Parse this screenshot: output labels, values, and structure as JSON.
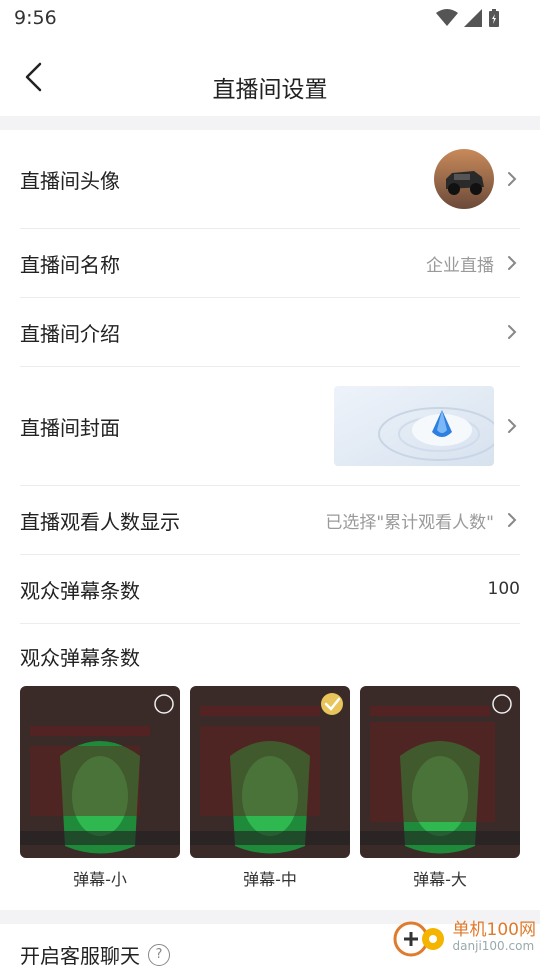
{
  "status": {
    "time": "9:56"
  },
  "header": {
    "title": "直播间设置"
  },
  "rows": {
    "avatar": {
      "label": "直播间头像"
    },
    "name": {
      "label": "直播间名称",
      "value": "企业直播"
    },
    "intro": {
      "label": "直播间介绍"
    },
    "cover": {
      "label": "直播间封面"
    },
    "viewers": {
      "label": "直播观看人数显示",
      "value": "已选择\"累计观看人数\""
    },
    "danmaku_count": {
      "label": "观众弹幕条数",
      "value": "100"
    }
  },
  "danmaku_section": {
    "label": "观众弹幕条数",
    "options": [
      {
        "caption": "弹幕-小",
        "selected": false
      },
      {
        "caption": "弹幕-中",
        "selected": true
      },
      {
        "caption": "弹幕-大",
        "selected": false
      }
    ]
  },
  "customer_chat": {
    "label": "开启客服聊天"
  },
  "watermark": {
    "brand": "单机100网",
    "url": "danji100.com"
  },
  "colors": {
    "accent": "#e07a2c",
    "divider": "#f3f3f5",
    "muted": "#9a9a9a"
  }
}
